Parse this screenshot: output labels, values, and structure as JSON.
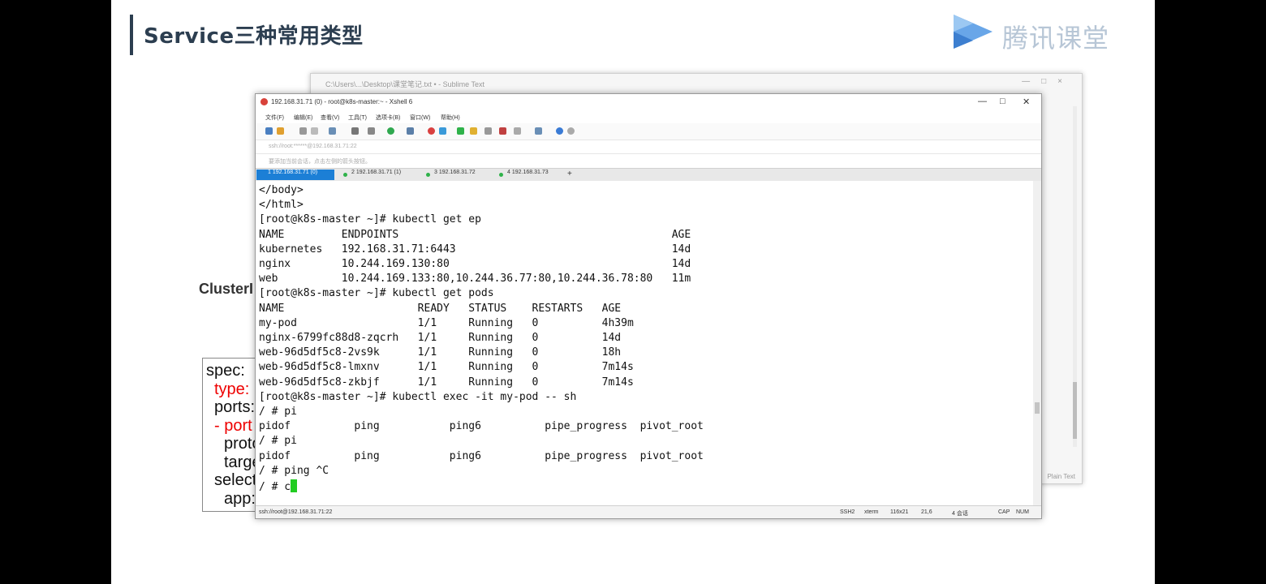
{
  "slide": {
    "title": "Service三种常用类型",
    "logo_text": "腾讯课堂",
    "cluster_label": "ClusterI",
    "code_lines": [
      {
        "text": "spec:",
        "color": "black"
      },
      {
        "text": "type:",
        "color": "red"
      },
      {
        "text": "ports:",
        "color": "black"
      },
      {
        "text": "- port",
        "color": "red"
      },
      {
        "text": "proto",
        "color": "black"
      },
      {
        "text": "targe",
        "color": "black"
      },
      {
        "text": "select",
        "color": "black"
      },
      {
        "text": "app:",
        "color": "black"
      }
    ]
  },
  "sublime": {
    "title": "C:\\Users\\...\\Desktop\\课堂笔记.txt • - Sublime Text",
    "status": "Plain Text",
    "controls": [
      "—",
      "□",
      "×"
    ]
  },
  "xshell": {
    "title": "192.168.31.71 (0) - root@k8s-master:~ - Xshell 6",
    "controls": {
      "minimize": "—",
      "maximize": "□",
      "close": "✕"
    },
    "menu": [
      "文件(F)",
      "编辑(E)",
      "查看(V)",
      "工具(T)",
      "选项卡(B)",
      "窗口(W)",
      "帮助(H)"
    ],
    "address": "ssh://root:******@192.168.31.71:22",
    "notice": "要添加当前会话，点击左侧的箭头按钮。",
    "tabs": [
      {
        "label": "1 192.168.31.71 (0)",
        "active": true
      },
      {
        "label": "2 192.168.31.71 (1)",
        "active": false
      },
      {
        "label": "3 192.168.31.72",
        "active": false
      },
      {
        "label": "4 192.168.31.73",
        "active": false
      }
    ],
    "tab_add": "+",
    "terminal_lines": [
      "</body>",
      "</html>",
      "[root@k8s-master ~]# kubectl get ep",
      "NAME         ENDPOINTS                                           AGE",
      "kubernetes   192.168.31.71:6443                                  14d",
      "nginx        10.244.169.130:80                                   14d",
      "web          10.244.169.133:80,10.244.36.77:80,10.244.36.78:80   11m",
      "[root@k8s-master ~]# kubectl get pods",
      "NAME                     READY   STATUS    RESTARTS   AGE",
      "my-pod                   1/1     Running   0          4h39m",
      "nginx-6799fc88d8-zqcrh   1/1     Running   0          14d",
      "web-96d5df5c8-2vs9k      1/1     Running   0          18h",
      "web-96d5df5c8-lmxnv      1/1     Running   0          7m14s",
      "web-96d5df5c8-zkbjf      1/1     Running   0          7m14s",
      "[root@k8s-master ~]# kubectl exec -it my-pod -- sh",
      "/ # pi",
      "pidof          ping           ping6          pipe_progress  pivot_root",
      "/ # pi",
      "pidof          ping           ping6          pipe_progress  pivot_root",
      "/ # ping ^C",
      "/ # c"
    ],
    "status": {
      "session": "ssh://root@192.168.31.71:22",
      "protocol": "SSH2",
      "term": "xterm",
      "size": "116x21",
      "pos": "21,6",
      "sessions": "4 会话",
      "caps": "CAP",
      "num": "NUM"
    }
  }
}
